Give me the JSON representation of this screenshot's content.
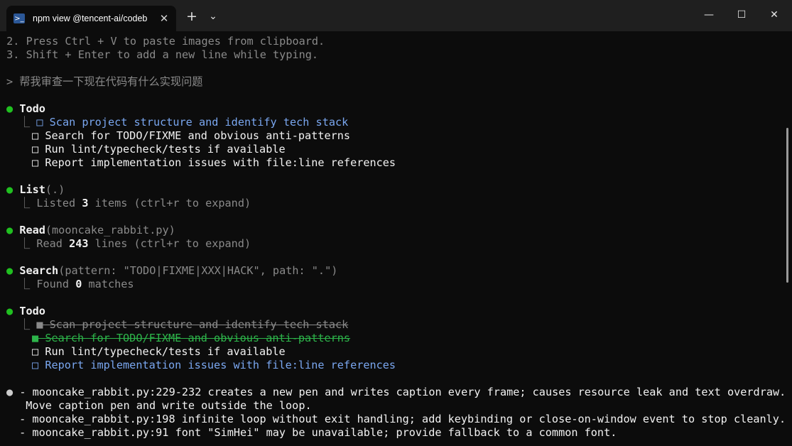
{
  "window": {
    "tab_title": "npm view @tencent-ai/codeb",
    "tab_icon": "powershell-icon",
    "close_glyph": "✕",
    "new_tab_glyph": "+",
    "dropdown_glyph": "⌄",
    "minimize_glyph": "—",
    "maximize_glyph": "☐",
    "window_close_glyph": "✕"
  },
  "terminal": {
    "tips": [
      " 2. Press Ctrl + V to paste images from clipboard.",
      " 3. Shift + Enter to add a new line while typing."
    ],
    "prompt": "> 帮我审查一下现在代码有什么实现问题",
    "todo1": {
      "title": "Todo",
      "items": [
        {
          "text": "Scan project structure and identify tech stack",
          "state": "active"
        },
        {
          "text": "Search for TODO/FIXME and obvious anti-patterns",
          "state": "pending"
        },
        {
          "text": "Run lint/typecheck/tests if available",
          "state": "pending"
        },
        {
          "text": "Report implementation issues with file:line references",
          "state": "pending"
        }
      ]
    },
    "list_tool": {
      "name": "List",
      "args": "(.)",
      "result_prefix": "Listed ",
      "result_count": "3",
      "result_suffix": " items (ctrl+r to expand)"
    },
    "read_tool": {
      "name": "Read",
      "args": "(mooncake_rabbit.py)",
      "result_prefix": "Read ",
      "result_count": "243",
      "result_suffix": " lines (ctrl+r to expand)"
    },
    "search_tool": {
      "name": "Search",
      "args": "(pattern: \"TODO|FIXME|XXX|HACK\", path: \".\")",
      "result_prefix": "Found ",
      "result_count": "0",
      "result_suffix": " matches"
    },
    "todo2": {
      "title": "Todo",
      "items": [
        {
          "text": "Scan project structure and identify tech stack",
          "state": "done"
        },
        {
          "text": "Search for TODO/FIXME and obvious anti-patterns",
          "state": "done-recent"
        },
        {
          "text": "Run lint/typecheck/tests if available",
          "state": "pending"
        },
        {
          "text": "Report implementation issues with file:line references",
          "state": "active"
        }
      ]
    },
    "findings": [
      "- mooncake_rabbit.py:229-232 creates a new pen and writes caption every frame; causes resource leak and text overdraw.",
      "  Move caption pen and write outside the loop.",
      " - mooncake_rabbit.py:198 infinite loop without exit handling; add keybinding or close-on-window event to stop cleanly.",
      " - mooncake_rabbit.py:91 font \"SimHei\" may be unavailable; provide fallback to a common font."
    ],
    "glyphs": {
      "bullet": "●",
      "branch": "⎿",
      "box_empty": "□",
      "box_filled": "■"
    },
    "colors": {
      "background": "#0c0c0c",
      "accent_blue": "#7aa7f0",
      "accent_green": "#2db44a",
      "dot_green": "#20c020"
    }
  }
}
